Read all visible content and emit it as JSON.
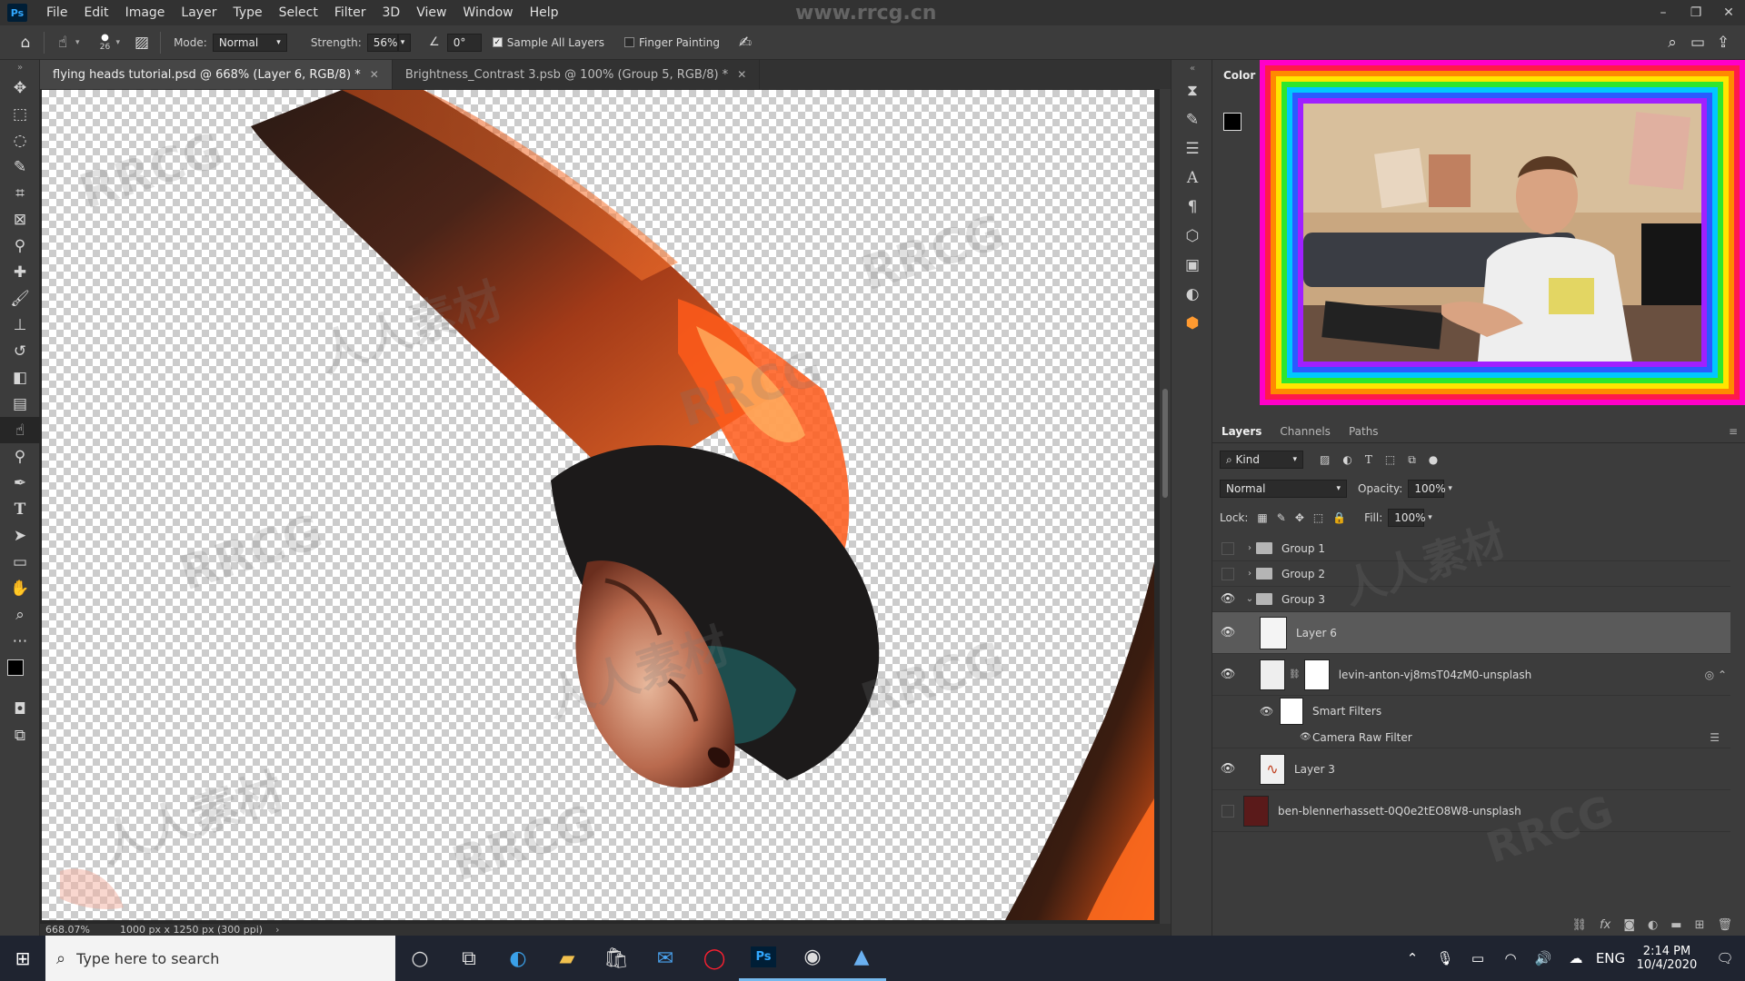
{
  "app": {
    "logo": "Ps"
  },
  "menu": [
    "File",
    "Edit",
    "Image",
    "Layer",
    "Type",
    "Select",
    "Filter",
    "3D",
    "View",
    "Window",
    "Help"
  ],
  "window_controls": {
    "minimize": "–",
    "restore": "❐",
    "close": "✕"
  },
  "options": {
    "brush_size": "26",
    "mode_label": "Mode:",
    "mode_value": "Normal",
    "strength_label": "Strength:",
    "strength_value": "56%",
    "angle_value": "0°",
    "sample_all_layers": "Sample All Layers",
    "finger_painting": "Finger Painting"
  },
  "doc_tabs": [
    {
      "title": "flying heads tutorial.psd @ 668% (Layer 6, RGB/8) *",
      "active": true
    },
    {
      "title": "Brightness_Contrast 3.psb @ 100% (Group 5, RGB/8) *",
      "active": false
    }
  ],
  "status": {
    "zoom": "668.07%",
    "doc_info": "1000 px x 1250 px (300 ppi)"
  },
  "color_panel": {
    "title": "Color"
  },
  "layers_panel": {
    "tabs": [
      "Layers",
      "Channels",
      "Paths"
    ],
    "filter_kind": "Kind",
    "blend_mode": "Normal",
    "opacity_label": "Opacity:",
    "opacity_value": "100%",
    "lock_label": "Lock:",
    "fill_label": "Fill:",
    "fill_value": "100%",
    "layers": [
      {
        "name": "Group 1",
        "type": "group",
        "visible": false,
        "expanded": false
      },
      {
        "name": "Group 2",
        "type": "group",
        "visible": false,
        "expanded": false
      },
      {
        "name": "Group 3",
        "type": "group",
        "visible": true,
        "expanded": true
      },
      {
        "name": "Layer 6",
        "type": "layer",
        "visible": true,
        "selected": true
      },
      {
        "name": "levin-anton-vj8msT04zM0-unsplash",
        "type": "smart",
        "visible": true
      },
      {
        "name": "Smart Filters",
        "type": "filters",
        "visible": true
      },
      {
        "name": "Camera Raw Filter",
        "type": "filter",
        "visible": true
      },
      {
        "name": "Layer 3",
        "type": "layer",
        "visible": true
      },
      {
        "name": "ben-blennerhassett-0Q0e2tEO8W8-unsplash",
        "type": "layer",
        "visible": false
      }
    ]
  },
  "taskbar": {
    "search_placeholder": "Type here to search",
    "time": "2:14 PM",
    "date": "10/4/2020",
    "lang": "ENG"
  },
  "watermark": {
    "site": "www.rrcg.cn",
    "brand": "RRCG",
    "cn": "人人素材"
  },
  "colors": {
    "accent": "#31a8ff",
    "panel": "#3c3c3c",
    "dark": "#323232"
  }
}
